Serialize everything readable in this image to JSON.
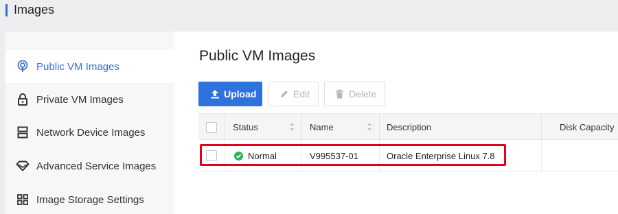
{
  "page": {
    "title": "Images"
  },
  "sidebar": {
    "items": [
      {
        "label": "Public VM Images",
        "icon": "broadcast-icon",
        "active": true
      },
      {
        "label": "Private VM Images",
        "icon": "lock-icon",
        "active": false
      },
      {
        "label": "Network Device Images",
        "icon": "server-icon",
        "active": false
      },
      {
        "label": "Advanced Service Images",
        "icon": "diamond-icon",
        "active": false
      },
      {
        "label": "Image Storage Settings",
        "icon": "grid-icon",
        "active": false
      }
    ]
  },
  "main": {
    "heading": "Public VM Images",
    "toolbar": {
      "upload_label": "Upload",
      "edit_label": "Edit",
      "delete_label": "Delete"
    },
    "table": {
      "columns": [
        "Status",
        "Name",
        "Description",
        "Disk Capacity"
      ],
      "rows": [
        {
          "status": "Normal",
          "name": "V995537-01",
          "description": "Oracle Enterprise Linux 7.8",
          "disk_capacity": ""
        }
      ]
    }
  },
  "colors": {
    "accent": "#2e72dd",
    "active_text": "#3a6fd0",
    "status_normal": "#2fb15a",
    "highlight": "#e3001b"
  }
}
